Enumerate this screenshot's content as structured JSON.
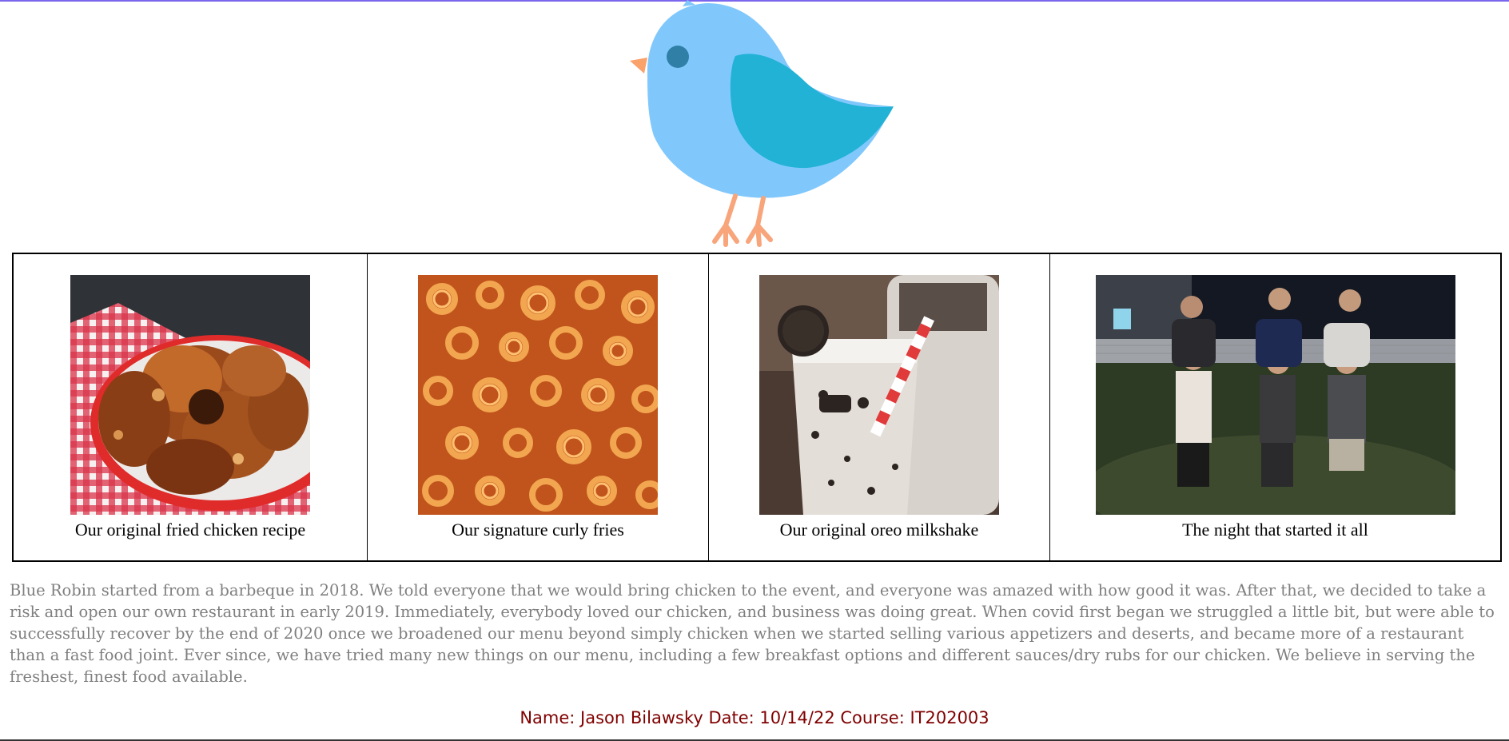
{
  "header": {
    "logo_icon": "blue-robin-bird-icon",
    "colors": {
      "bird_body": "#80c8fc",
      "bird_wing": "#22b2d6",
      "bird_eye": "#2f7fa7",
      "beak": "#f9a26c",
      "legs": "#f8a57b",
      "top_rule": "#7b66ee"
    }
  },
  "gallery": {
    "items": [
      {
        "image": "fried-chicken-photo",
        "caption": "Our original fried chicken recipe"
      },
      {
        "image": "curly-fries-photo",
        "caption": "Our signature curly fries"
      },
      {
        "image": "oreo-milkshake-photo",
        "caption": "Our original oreo milkshake"
      },
      {
        "image": "group-night-photo",
        "caption": "The night that started it all"
      }
    ]
  },
  "story": {
    "text": "Blue Robin started from a barbeque in 2018. We told everyone that we would bring chicken to the event, and everyone was amazed with how good it was. After that, we decided to take a risk and open our own restaurant in early 2019. Immediately, everybody loved our chicken, and business was doing great. When covid first began we struggled a little bit, but were able to successfully recover by the end of 2020 once we broadened our menu beyond simply chicken when we started selling various appetizers and deserts, and became more of a restaurant than a fast food joint. Ever since, we have tried many new things on our menu, including a few breakfast options and different sauces/dry rubs for our chicken. We believe in serving the freshest, finest food available."
  },
  "footer": {
    "text": "Name: Jason Bilawsky Date: 10/14/22 Course: IT202003",
    "color": "#800000"
  }
}
